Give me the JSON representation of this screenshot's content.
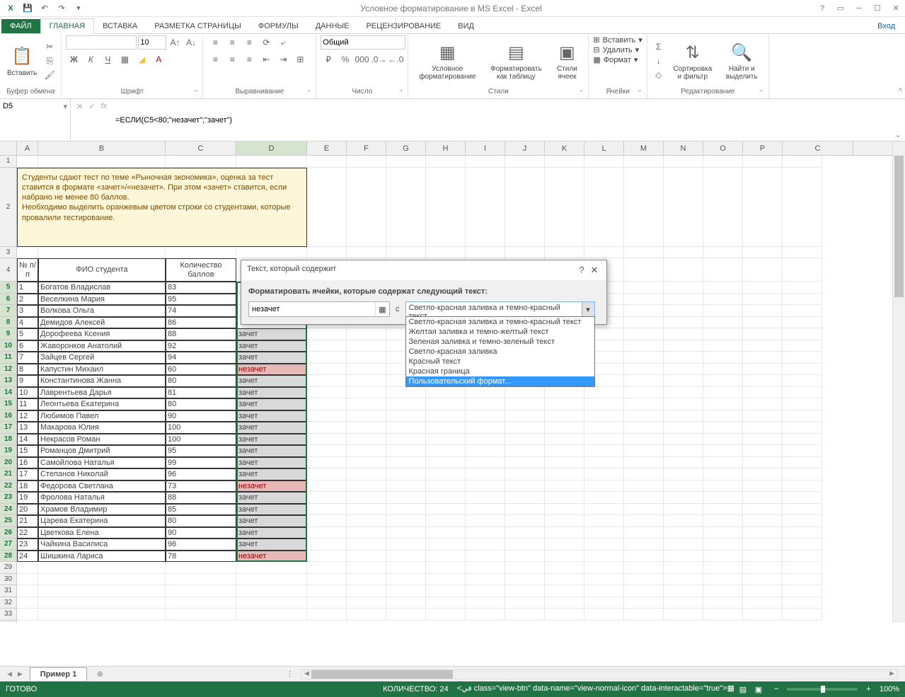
{
  "app": {
    "title": "Условное форматирование в MS Excel - Excel",
    "login": "Вход"
  },
  "tabs": {
    "file": "ФАЙЛ",
    "home": "ГЛАВНАЯ",
    "insert": "ВСТАВКА",
    "layout": "РАЗМЕТКА СТРАНИЦЫ",
    "formulas": "ФОРМУЛЫ",
    "data": "ДАННЫЕ",
    "review": "РЕЦЕНЗИРОВАНИЕ",
    "view": "ВИД"
  },
  "ribbon": {
    "clipboard": {
      "paste": "Вставить",
      "label": "Буфер обмена"
    },
    "font": {
      "name": "",
      "size": "10",
      "label": "Шрифт"
    },
    "alignment": {
      "label": "Выравнивание"
    },
    "number": {
      "format": "Общий",
      "label": "Число"
    },
    "styles": {
      "cond": "Условное форматирование",
      "table": "Форматировать как таблицу",
      "cell": "Стили ячеек",
      "label": "Стили"
    },
    "cells": {
      "insert": "Вставить",
      "delete": "Удалить",
      "format": "Формат",
      "label": "Ячейки"
    },
    "editing": {
      "sort": "Сортировка и фильтр",
      "find": "Найти и выделить",
      "label": "Редактирование"
    }
  },
  "namebox": "D5",
  "formula": "=ЕСЛИ(C5<80;\"незачет\";\"зачет\")",
  "note": "Студенты сдают тест по теме «Рыночная экономика», оценка за тест ставится в формате «зачет»/«незачет». При этом «зачет» ставится, если набрано не менее 80 баллов.\nНеобходимо выделить оранжевым цветом строки со студентами, которые провалили тестирование.",
  "headers": {
    "num": "№ п/п",
    "fio": "ФИО студента",
    "score": "Количество баллов"
  },
  "students": [
    {
      "n": "1",
      "fio": "Богатов Владислав",
      "score": "83",
      "res": ""
    },
    {
      "n": "2",
      "fio": "Веселкина Мария",
      "score": "95",
      "res": ""
    },
    {
      "n": "3",
      "fio": "Волкова Ольга",
      "score": "74",
      "res": ""
    },
    {
      "n": "4",
      "fio": "Демидов Алексей",
      "score": "86",
      "res": ""
    },
    {
      "n": "5",
      "fio": "Дорофеева Ксения",
      "score": "88",
      "res": "зачет"
    },
    {
      "n": "6",
      "fio": "Жаворонков Анатолий",
      "score": "92",
      "res": "зачет"
    },
    {
      "n": "7",
      "fio": "Зайцев Сергей",
      "score": "94",
      "res": "зачет"
    },
    {
      "n": "8",
      "fio": "Капустин Михаил",
      "score": "60",
      "res": "незачет"
    },
    {
      "n": "9",
      "fio": "Константинова Жанна",
      "score": "80",
      "res": "зачет"
    },
    {
      "n": "10",
      "fio": "Лаврентьева Дарья",
      "score": "81",
      "res": "зачет"
    },
    {
      "n": "11",
      "fio": "Леонтьева Екатерина",
      "score": "80",
      "res": "зачет"
    },
    {
      "n": "12",
      "fio": "Любимов Павел",
      "score": "90",
      "res": "зачет"
    },
    {
      "n": "13",
      "fio": "Макарова Юлия",
      "score": "100",
      "res": "зачет"
    },
    {
      "n": "14",
      "fio": "Некрасов Роман",
      "score": "100",
      "res": "зачет"
    },
    {
      "n": "15",
      "fio": "Романцов Дмитрий",
      "score": "95",
      "res": "зачет"
    },
    {
      "n": "16",
      "fio": "Самойлова Наталья",
      "score": "99",
      "res": "зачет"
    },
    {
      "n": "17",
      "fio": "Степанов Николай",
      "score": "96",
      "res": "зачет"
    },
    {
      "n": "18",
      "fio": "Федорова Светлана",
      "score": "73",
      "res": "незачет"
    },
    {
      "n": "19",
      "fio": "Фролова Наталья",
      "score": "88",
      "res": "зачет"
    },
    {
      "n": "20",
      "fio": "Храмов Владимир",
      "score": "85",
      "res": "зачет"
    },
    {
      "n": "21",
      "fio": "Царева Екатерина",
      "score": "80",
      "res": "зачет"
    },
    {
      "n": "22",
      "fio": "Цветкова Елена",
      "score": "90",
      "res": "зачет"
    },
    {
      "n": "23",
      "fio": "Чайкина Василиса",
      "score": "96",
      "res": "зачет"
    },
    {
      "n": "24",
      "fio": "Шишкина Лариса",
      "score": "78",
      "res": "незачет"
    }
  ],
  "dialog": {
    "title": "Текст, который содержит",
    "label": "Форматировать ячейки, которые содержат следующий текст:",
    "input": "незачет",
    "with": "с",
    "selected": "Светло-красная заливка и темно-красный текст",
    "options": [
      "Светло-красная заливка и темно-красный текст",
      "Желтая заливка и темно-желтый текст",
      "Зеленая заливка и темно-зеленый текст",
      "Светло-красная заливка",
      "Красный текст",
      "Красная граница",
      "Пользовательский формат..."
    ]
  },
  "sheet": {
    "name": "Пример 1"
  },
  "status": {
    "ready": "ГОТОВО",
    "count": "КОЛИЧЕСТВО: 24",
    "zoom": "100%"
  },
  "cols": [
    "A",
    "B",
    "C",
    "D",
    "E",
    "F",
    "G",
    "H",
    "I",
    "J",
    "K",
    "L",
    "M",
    "N",
    "O",
    "P",
    "C"
  ]
}
